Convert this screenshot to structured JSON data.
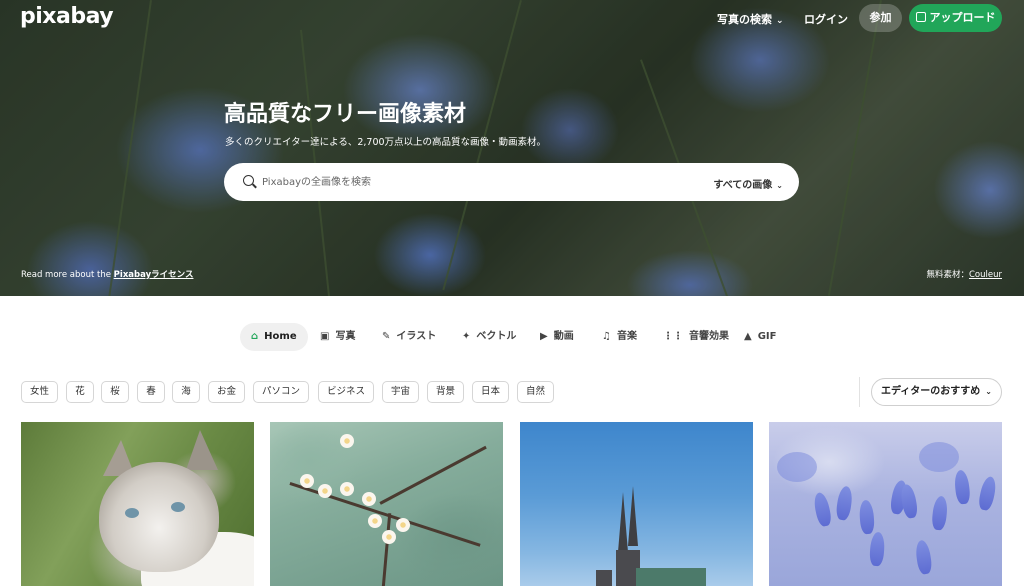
{
  "header": {
    "logo": "pixabay",
    "explore_label": "写真の検索",
    "login_label": "ログイン",
    "join_label": "参加",
    "upload_label": "アップロード"
  },
  "hero": {
    "title": "高品質なフリー画像素材",
    "subtitle": "多くのクリエイター達による、2,700万点以上の高品質な画像・動画素材。",
    "search_placeholder": "Pixabayの全画像を検索",
    "search_scope": "すべての画像",
    "license_prefix": "Read more about the ",
    "license_link": "Pixabayライセンス",
    "credit_prefix": "無料素材：",
    "credit_author": "Couleur"
  },
  "tabs": [
    {
      "label": "Home",
      "icon": "home-icon",
      "active": true
    },
    {
      "label": "写真",
      "icon": "camera-icon",
      "active": false
    },
    {
      "label": "イラスト",
      "icon": "brush-icon",
      "active": false
    },
    {
      "label": "ベクトル",
      "icon": "pen-nib-icon",
      "active": false
    },
    {
      "label": "動画",
      "icon": "video-camera-icon",
      "active": false
    },
    {
      "label": "音楽",
      "icon": "music-note-icon",
      "active": false
    },
    {
      "label": "音響効果",
      "icon": "waveform-icon",
      "active": false
    },
    {
      "label": "GIF",
      "icon": "flame-icon",
      "active": false
    }
  ],
  "tags": [
    "女性",
    "花",
    "桜",
    "春",
    "海",
    "お金",
    "パソコン",
    "ビジネス",
    "宇宙",
    "背景",
    "日本",
    "自然"
  ],
  "sort": {
    "label": "エディターのおすすめ"
  },
  "colors": {
    "accent": "#21a659",
    "active_tab_bg": "#f0f0f0"
  }
}
